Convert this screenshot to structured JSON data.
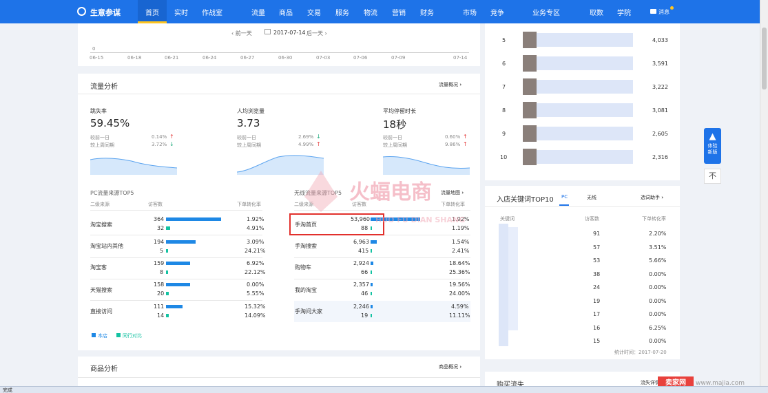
{
  "nav": {
    "brand": "生意参谋",
    "items": [
      "首页",
      "实时",
      "作战室",
      "流量",
      "商品",
      "交易",
      "服务",
      "物流",
      "营销",
      "财务",
      "市场",
      "竞争",
      "业务专区",
      "取数",
      "学院"
    ],
    "message": "消息"
  },
  "date_nav": {
    "prev": "前一天",
    "date": "2017-07-14",
    "next": "后一天"
  },
  "timeline": {
    "zero": "0",
    "ticks": [
      "06-15",
      "06-18",
      "06-21",
      "06-24",
      "06-27",
      "06-30",
      "07-03",
      "07-06",
      "07-09",
      "07-14"
    ]
  },
  "flow": {
    "title": "流量分析",
    "overview_link": "流量概况",
    "metrics": [
      {
        "label": "跳失率",
        "value": "59.45%",
        "cmp1_label": "较前一日",
        "cmp1": "0.14%",
        "cmp2_label": "较上周同期",
        "cmp2": "3.72%"
      },
      {
        "label": "人均浏览量",
        "value": "3.73",
        "cmp1_label": "较前一日",
        "cmp1": "2.69%",
        "cmp2_label": "较上周同期",
        "cmp2": "4.99%"
      },
      {
        "label": "平均停留时长",
        "value": "18秒",
        "cmp1_label": "较前一日",
        "cmp1": "0.60%",
        "cmp2_label": "较上周同期",
        "cmp2": "9.86%"
      }
    ],
    "pc_source": {
      "title": "PC流量来源TOP5",
      "headers": [
        "二级来源",
        "访客数",
        "下单转化率"
      ],
      "rows": [
        {
          "name": "淘宝搜索",
          "v1": "364",
          "v2": "32",
          "r1": "1.92%",
          "r2": "4.91%"
        },
        {
          "name": "淘宝站内其他",
          "v1": "194",
          "v2": "5",
          "r1": "3.09%",
          "r2": "24.21%"
        },
        {
          "name": "淘宝客",
          "v1": "159",
          "v2": "8",
          "r1": "6.92%",
          "r2": "22.12%"
        },
        {
          "name": "天猫搜索",
          "v1": "158",
          "v2": "20",
          "r1": "0.00%",
          "r2": "5.55%"
        },
        {
          "name": "直接访问",
          "v1": "111",
          "v2": "14",
          "r1": "15.32%",
          "r2": "14.09%"
        }
      ],
      "legend": [
        "本店",
        "同行对比"
      ]
    },
    "wireless_source": {
      "title": "无线流量来源TOP5",
      "map_link": "流量地图",
      "headers": [
        "二级来源",
        "访客数",
        "下单转化率"
      ],
      "rows": [
        {
          "name": "手淘首页",
          "v1": "53,960",
          "v2": "88",
          "r1": "1.92%",
          "r2": "1.19%"
        },
        {
          "name": "手淘搜索",
          "v1": "6,963",
          "v2": "415",
          "r1": "1.54%",
          "r2": "2.41%"
        },
        {
          "name": "购物车",
          "v1": "2,924",
          "v2": "66",
          "r1": "18.64%",
          "r2": "25.36%"
        },
        {
          "name": "我的淘宝",
          "v1": "2,357",
          "v2": "46",
          "r1": "19.56%",
          "r2": "24.00%"
        },
        {
          "name": "手淘问大家",
          "v1": "2,246",
          "v2": "19",
          "r1": "4.59%",
          "r2": "11.11%"
        }
      ]
    }
  },
  "goods": {
    "title": "商品分析",
    "overview_link": "商品概况"
  },
  "ranking": {
    "rows": [
      {
        "rank": "5",
        "value": "4,033"
      },
      {
        "rank": "6",
        "value": "3,591"
      },
      {
        "rank": "7",
        "value": "3,222"
      },
      {
        "rank": "8",
        "value": "3,081"
      },
      {
        "rank": "9",
        "value": "2,605"
      },
      {
        "rank": "10",
        "value": "2,316"
      }
    ]
  },
  "keywords": {
    "title": "入店关键词TOP10",
    "tabs": [
      "PC",
      "无线"
    ],
    "helper": "选词助手",
    "headers": [
      "关键词",
      "访客数",
      "下单转化率"
    ],
    "rows": [
      {
        "v": "91",
        "r": "2.20%"
      },
      {
        "v": "57",
        "r": "3.51%"
      },
      {
        "v": "53",
        "r": "5.66%"
      },
      {
        "v": "38",
        "r": "0.00%"
      },
      {
        "v": "24",
        "r": "0.00%"
      },
      {
        "v": "19",
        "r": "0.00%"
      },
      {
        "v": "17",
        "r": "0.00%"
      },
      {
        "v": "16",
        "r": "6.25%"
      },
      {
        "v": "15",
        "r": "0.00%"
      }
    ],
    "stat_time": "统计时间：2017-07-20"
  },
  "purchase": {
    "title": "购买流失",
    "link": "流失详情"
  },
  "side": {
    "rocket": "体验新版",
    "top": "不"
  },
  "watermark": {
    "brand": "火蝠电商",
    "pinyin": "HUO FU DIAN SHANG",
    "site": "www.majia.com",
    "badge": "卖家网"
  },
  "status": "完成",
  "colors": {
    "nav": "#1e73e8",
    "accent": "#ffc51f",
    "bar": "#1e88e5",
    "bar_peer": "#13c2a2",
    "up": "#e43c3c",
    "down": "#1aa87a"
  }
}
